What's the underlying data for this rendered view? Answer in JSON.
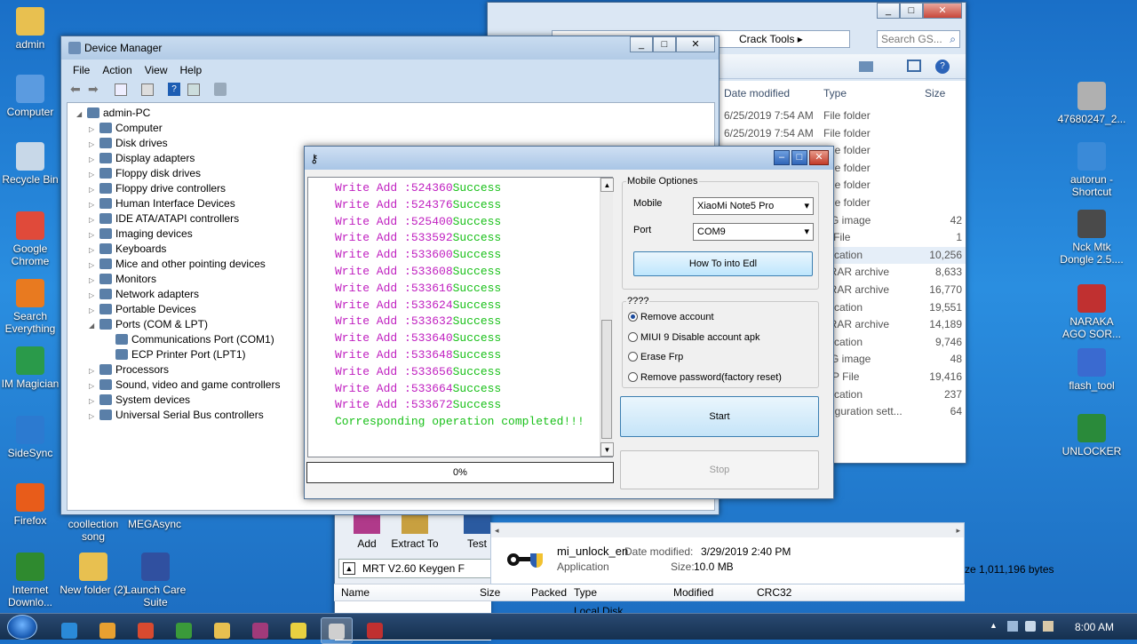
{
  "desktop": {
    "left_icons": [
      {
        "label": "admin",
        "icon": "folder-user-icon"
      },
      {
        "label": "Computer",
        "icon": "computer-icon"
      },
      {
        "label": "Recycle Bin",
        "icon": "recycle-bin-icon"
      },
      {
        "label": "Google Chrome",
        "icon": "chrome-icon"
      },
      {
        "label": "Search Everything",
        "icon": "search-everything-icon"
      },
      {
        "label": "IM Magician",
        "icon": "im-magician-icon"
      },
      {
        "label": "SideSync",
        "icon": "sidesync-icon"
      },
      {
        "label": "Firefox",
        "icon": "firefox-icon"
      },
      {
        "label": "Internet Downlo...",
        "icon": "idm-icon"
      }
    ],
    "bottom_icons": [
      {
        "label": "coollection song",
        "icon": "winrar-icon"
      },
      {
        "label": "MEGAsync",
        "icon": "megasync-icon"
      },
      {
        "label": "New folder (2)",
        "icon": "folder-icon"
      },
      {
        "label": "Launch Care Suite",
        "icon": "care-suite-icon"
      }
    ],
    "right_icons": [
      {
        "label": "47680247_2...",
        "icon": "image-thumb-icon"
      },
      {
        "label": "autorun - Shortcut",
        "icon": "shortcut-icon"
      },
      {
        "label": "Nck Mtk Dongle 2.5....",
        "icon": "nck-icon"
      },
      {
        "label": "NARAKA AGO SOR...",
        "icon": "naraka-icon"
      },
      {
        "label": "flash_tool",
        "icon": "flash-tool-icon"
      },
      {
        "label": "UNLOCKER",
        "icon": "unlocker-icon"
      }
    ]
  },
  "device_manager": {
    "title": "Device Manager",
    "menu": [
      "File",
      "Action",
      "View",
      "Help"
    ],
    "root": "admin-PC",
    "items": [
      "Computer",
      "Disk drives",
      "Display adapters",
      "Floppy disk drives",
      "Floppy drive controllers",
      "Human Interface Devices",
      "IDE ATA/ATAPI controllers",
      "Imaging devices",
      "Keyboards",
      "Mice and other pointing devices",
      "Monitors",
      "Network adapters",
      "Portable Devices",
      "Ports (COM & LPT)"
    ],
    "ports_children": [
      "Communications Port (COM1)",
      "ECP Printer Port (LPT1)"
    ],
    "items_after": [
      "Processors",
      "Sound, video and game controllers",
      "System devices",
      "Universal Serial Bus controllers"
    ]
  },
  "explorer": {
    "breadcrumb_tail": "Crack Tools",
    "search_placeholder": "Search GS...",
    "columns": {
      "date": "Date modified",
      "type": "Type",
      "size": "Size"
    },
    "rows": [
      {
        "date": "6/25/2019 7:54 AM",
        "type": "File folder",
        "size": ""
      },
      {
        "date": "6/25/2019 7:54 AM",
        "type": "File folder",
        "size": ""
      },
      {
        "date": "",
        "type": "File folder",
        "size": ""
      },
      {
        "date": "",
        "type": "File folder",
        "size": ""
      },
      {
        "date": "",
        "type": "File folder",
        "size": ""
      },
      {
        "date": "",
        "type": "File folder",
        "size": ""
      },
      {
        "date": "",
        "type": "EG image",
        "size": "42"
      },
      {
        "date": "",
        "type": "Y File",
        "size": "1"
      },
      {
        "date": "",
        "type": "plication",
        "size": "10,256"
      },
      {
        "date": "",
        "type": "nRAR archive",
        "size": "8,633"
      },
      {
        "date": "",
        "type": "nRAR archive",
        "size": "16,770"
      },
      {
        "date": "",
        "type": "plication",
        "size": "19,551"
      },
      {
        "date": "",
        "type": "nRAR archive",
        "size": "14,189"
      },
      {
        "date": "",
        "type": "plication",
        "size": "9,746"
      },
      {
        "date": "",
        "type": "EG image",
        "size": "48"
      },
      {
        "date": "",
        "type": "MP File",
        "size": "19,416"
      },
      {
        "date": "",
        "type": "plication",
        "size": "237"
      },
      {
        "date": "",
        "type": "nfiguration sett...",
        "size": "64"
      }
    ],
    "details": {
      "name": "mi_unlock_en",
      "date_label": "Date modified:",
      "date_value": "3/29/2019 2:40 PM",
      "type": "Application",
      "size_label": "Size:",
      "size_value": "10.0 MB"
    }
  },
  "winrar": {
    "toolbar": [
      "Add",
      "Extract To",
      "Test"
    ],
    "path": "MRT V2.60 Keygen F",
    "columns": [
      "Name",
      "Size",
      "Packed",
      "Type",
      "Modified",
      "CRC32"
    ],
    "first_row": "Local Disk",
    "total": "ze 1,011,196 bytes"
  },
  "tool": {
    "log": [
      {
        "addr": "Write Add :524360",
        "status": "Success"
      },
      {
        "addr": "Write Add :524376",
        "status": "Success"
      },
      {
        "addr": "Write Add :525400",
        "status": "Success"
      },
      {
        "addr": "Write Add :533592",
        "status": "Success"
      },
      {
        "addr": "Write Add :533600",
        "status": "Success"
      },
      {
        "addr": "Write Add :533608",
        "status": "Success"
      },
      {
        "addr": "Write Add :533616",
        "status": "Success"
      },
      {
        "addr": "Write Add :533624",
        "status": "Success"
      },
      {
        "addr": "Write Add :533632",
        "status": "Success"
      },
      {
        "addr": "Write Add :533640",
        "status": "Success"
      },
      {
        "addr": "Write Add :533648",
        "status": "Success"
      },
      {
        "addr": "Write Add :533656",
        "status": "Success"
      },
      {
        "addr": "Write Add :533664",
        "status": "Success"
      },
      {
        "addr": "Write Add :533672",
        "status": "Success"
      }
    ],
    "completed": "Corresponding operation completed!!!",
    "progress_text": "0%",
    "mobile_group": "Mobile Optiones",
    "mobile_label": "Mobile",
    "mobile_value": "XiaoMi Note5 Pro",
    "port_label": "Port",
    "port_value": "COM9",
    "edl_button": "How To into Edl",
    "options_group": "????",
    "options": [
      "Remove account",
      "MIUI 9 Disable account apk",
      "Erase Frp",
      "Remove password(factory reset)"
    ],
    "selected_option": 0,
    "start_button": "Start",
    "stop_button": "Stop"
  },
  "taskbar": {
    "clock": "8:00 AM"
  }
}
